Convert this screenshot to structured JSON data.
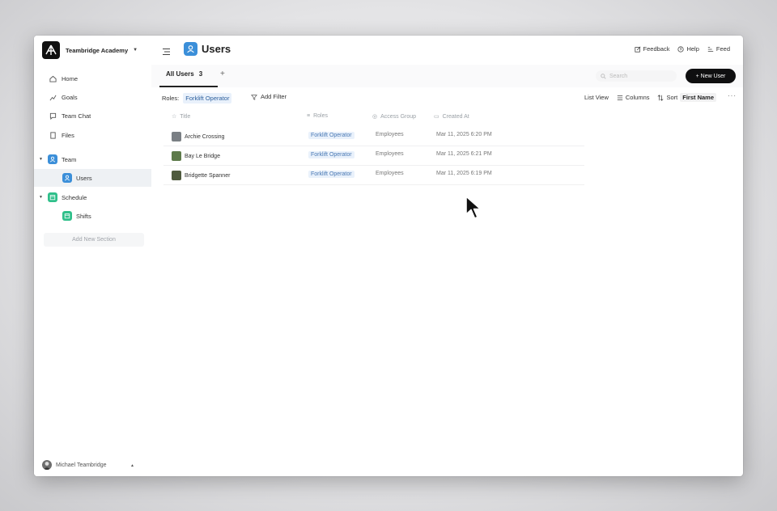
{
  "org": {
    "name": "Teambridge Academy"
  },
  "sidebar": {
    "items": [
      {
        "label": "Home",
        "icon": "home-icon"
      },
      {
        "label": "Goals",
        "icon": "goals-icon"
      },
      {
        "label": "Team Chat",
        "icon": "chat-icon"
      },
      {
        "label": "Files",
        "icon": "file-icon"
      }
    ],
    "sections": [
      {
        "label": "Team",
        "color": "#3b8fd9",
        "children": [
          {
            "label": "Users"
          }
        ]
      },
      {
        "label": "Schedule",
        "color": "#2fbf8a",
        "children": [
          {
            "label": "Shifts"
          }
        ]
      }
    ],
    "add_section": "Add New Section",
    "user": "Michael Teambridge"
  },
  "header": {
    "title": "Users",
    "feedback": "Feedback",
    "help": "Help",
    "feed": "Feed"
  },
  "tabs": {
    "active_label": "All Users",
    "active_count": "3"
  },
  "search": {
    "placeholder": "Search"
  },
  "new_user_label": "+ New User",
  "filters": {
    "roles_label": "Roles:",
    "roles_value": "Forklift Operator",
    "add_filter": "Add Filter"
  },
  "view": {
    "list_view": "List View",
    "columns": "Columns",
    "sort": "Sort",
    "sort_value": "First Name"
  },
  "table": {
    "columns": [
      "Title",
      "Roles",
      "Access Group",
      "Created At"
    ],
    "rows": [
      {
        "title": "Archie Crossing",
        "role": "Forklift Operator",
        "access": "Employees",
        "created": "Mar 11, 2025 6:20 PM"
      },
      {
        "title": "Bay Le Bridge",
        "role": "Forklift Operator",
        "access": "Employees",
        "created": "Mar 11, 2025 6:21 PM"
      },
      {
        "title": "Bridgette Spanner",
        "role": "Forklift Operator",
        "access": "Employees",
        "created": "Mar 11, 2025 6:19 PM"
      }
    ]
  },
  "colors": {
    "accent": "#3b8fd9",
    "schedule": "#2fbf8a",
    "chip_bg": "#e9f1fb"
  }
}
